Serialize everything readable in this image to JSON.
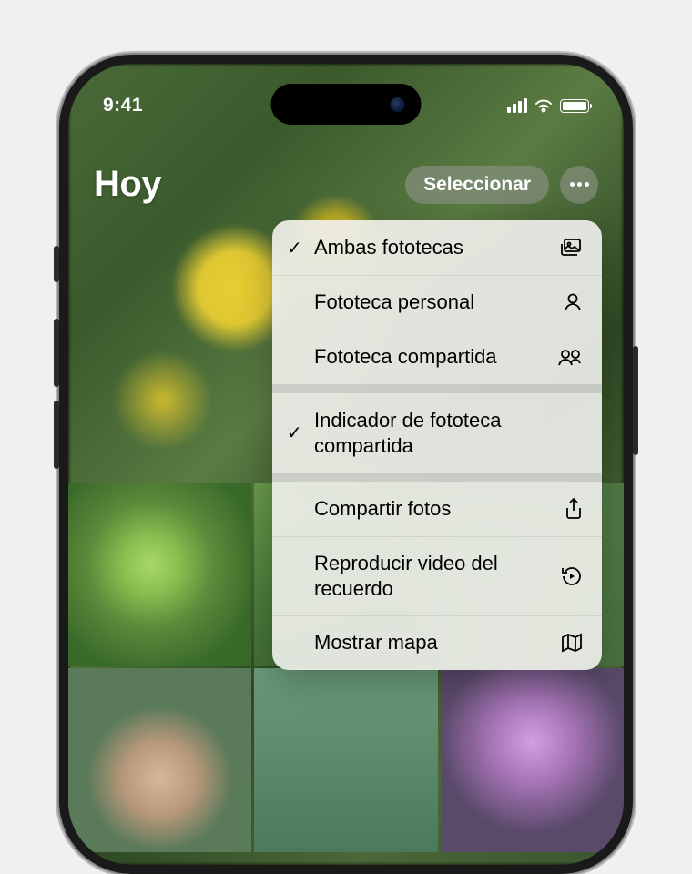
{
  "status": {
    "time": "9:41"
  },
  "header": {
    "title": "Hoy",
    "select_label": "Seleccionar"
  },
  "menu": {
    "items": [
      {
        "label": "Ambas fototecas",
        "checked": true,
        "icon": "stacked-photos-icon"
      },
      {
        "label": "Fototeca personal",
        "checked": false,
        "icon": "person-icon"
      },
      {
        "label": "Fototeca compartida",
        "checked": false,
        "icon": "people-icon"
      }
    ],
    "toggles": [
      {
        "label": "Indicador de fototeca compartida",
        "checked": true
      }
    ],
    "actions": [
      {
        "label": "Compartir fotos",
        "icon": "share-icon"
      },
      {
        "label": "Reproducir video del recuerdo",
        "icon": "replay-icon"
      },
      {
        "label": "Mostrar mapa",
        "icon": "map-icon"
      }
    ]
  }
}
